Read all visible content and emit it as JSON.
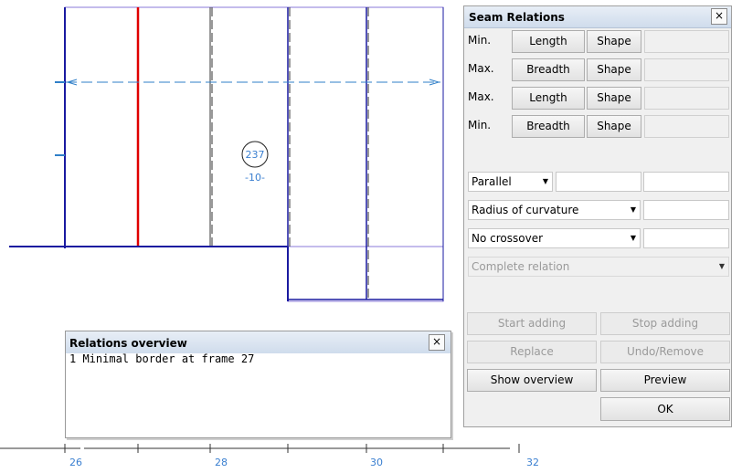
{
  "drawing": {
    "frame_label_circle": "237",
    "frame_label_sub": "-10-",
    "axis_labels": [
      "26",
      "28",
      "30",
      "32"
    ]
  },
  "seam_relations": {
    "title": "Seam Relations",
    "close": "×",
    "rows": [
      {
        "label": "Min.",
        "button": "Length",
        "shape": "Shape"
      },
      {
        "label": "Max.",
        "button": "Breadth",
        "shape": "Shape"
      },
      {
        "label": "Max.",
        "button": "Length",
        "shape": "Shape"
      },
      {
        "label": "Min.",
        "button": "Breadth",
        "shape": "Shape"
      }
    ],
    "parallel_select": "Parallel",
    "radius_select": "Radius of curvature",
    "crossover_select": "No crossover",
    "complete_select": "Complete relation",
    "start_adding": "Start adding",
    "stop_adding": "Stop adding",
    "replace": "Replace",
    "undo_remove": "Undo/Remove",
    "show_overview": "Show overview",
    "preview": "Preview",
    "ok": "OK"
  },
  "overview": {
    "title": "Relations overview",
    "close": "×",
    "lines": [
      "1 Minimal border at frame 27"
    ]
  },
  "colors": {
    "outline": "#1a1aa0",
    "seam_red": "#e00000",
    "dashed_blue": "#2f7fc8",
    "frame_outline": "#8a7ad8"
  }
}
